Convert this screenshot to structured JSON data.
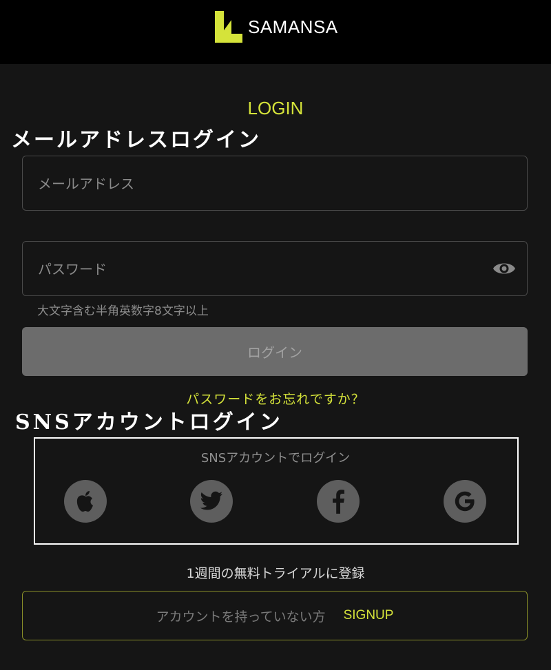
{
  "header": {
    "brand": "SAMANSA"
  },
  "login_title": "LOGIN",
  "annotations": {
    "email_login": "メールアドレスログイン",
    "sns_login": "SNSアカウントログイン"
  },
  "form": {
    "email_placeholder": "メールアドレス",
    "password_placeholder": "パスワード",
    "password_hint": "大文字含む半角英数字8文字以上",
    "login_button": "ログイン",
    "forgot_password": "パスワードをお忘れですか？"
  },
  "sns": {
    "title": "SNSアカウントでログイン",
    "providers": [
      {
        "name": "Apple",
        "icon": "apple-icon"
      },
      {
        "name": "Twitter",
        "icon": "twitter-icon"
      },
      {
        "name": "Facebook",
        "icon": "facebook-icon"
      },
      {
        "name": "Google",
        "icon": "google-icon"
      }
    ]
  },
  "signup": {
    "trial_text": "1週間の無料トライアルに登録",
    "prompt": "アカウントを持っていない方",
    "link": "SIGNUP"
  },
  "colors": {
    "accent": "#d5e33a",
    "background": "#151515",
    "header": "#000000",
    "icon_bg": "#5e5e5e"
  }
}
